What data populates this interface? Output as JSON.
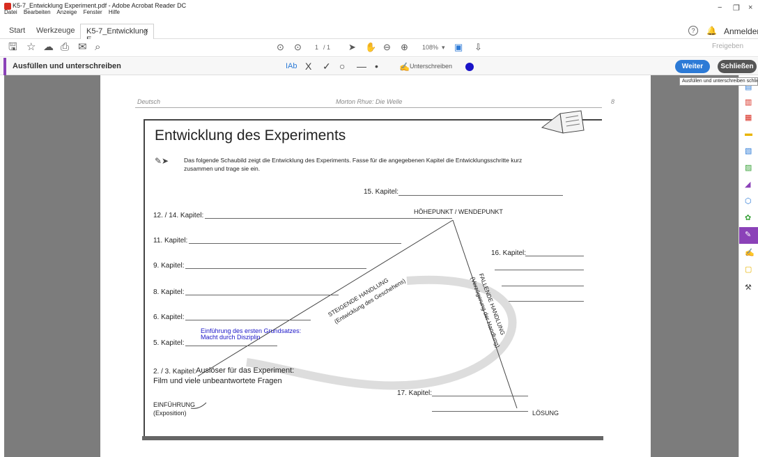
{
  "window": {
    "title": "K5-7_Entwicklung Experiment.pdf - Adobe Acrobat Reader DC",
    "menu": [
      "Datei",
      "Bearbeiten",
      "Anzeige",
      "Fenster",
      "Hilfe"
    ],
    "controls": {
      "minimize": "−",
      "restore": "❐",
      "close": "×"
    }
  },
  "tabs": {
    "home": "Start",
    "tools": "Werkzeuge",
    "document": "K5-7_Entwicklung E...",
    "close": "×"
  },
  "account": {
    "help": "?",
    "signin": "Anmelden",
    "share": "Freigeben"
  },
  "toolbar": {
    "page_current": "1",
    "page_total": "/ 1",
    "zoom": "108%"
  },
  "fillsign": {
    "title": "Ausfüllen und unterschreiben",
    "tools": {
      "text": "IAb",
      "cross": "X",
      "check": "✓",
      "circle": "○",
      "line": "—",
      "dot": "•"
    },
    "sign_label": "Unterschreiben",
    "accent": "#8b42b8",
    "ink_color": "#1a14c8",
    "next_button": "Weiter",
    "close_button": "Schließen",
    "tooltip": "Ausfüllen und unterschreiben schließen"
  },
  "document": {
    "header_left": "Deutsch",
    "header_center": "Morton Rhue: Die Welle",
    "header_page": "8",
    "title": "Entwicklung des Experiments",
    "instruction_line1": "Das folgende Schaubild zeigt die Entwicklung des Experiments. Fasse für die angegebenen Kapitel die Entwicklungsschritte kurz",
    "instruction_line2": "zusammen und trage sie ein.",
    "chapters": {
      "k15": "15. Kapitel:",
      "k12_14": "12. / 14. Kapitel:",
      "k11": "11. Kapitel:",
      "k9": "9. Kapitel:",
      "k8": "8. Kapitel:",
      "k6": "6. Kapitel:",
      "k5": "5. Kapitel:",
      "k2_3": "2. / 3. Kapitel:",
      "k16": "16. Kapitel:",
      "k17": "17. Kapitel:"
    },
    "climax": "HÖHEPUNKT / WENDEPUNKT",
    "rising": "STEIGENDE HANDLUNG",
    "rising_sub": "(Entwicklung des Geschehens)",
    "falling": "FALLENDE HANDLUNG",
    "falling_sub": "(Verzögerung der Handlung)",
    "intro": "EINFÜHRUNG",
    "intro_sub": "(Exposition)",
    "resolution": "LÖSUNG",
    "filled_k5_line1": "Einführung des ersten Grundsatzes:",
    "filled_k5_line2": "Macht durch Disziplin",
    "handwritten_k2_3_line1": "Auslöser für das Experiment:",
    "handwritten_k2_3_line2": "Film und viele unbeantwortete Fragen"
  }
}
